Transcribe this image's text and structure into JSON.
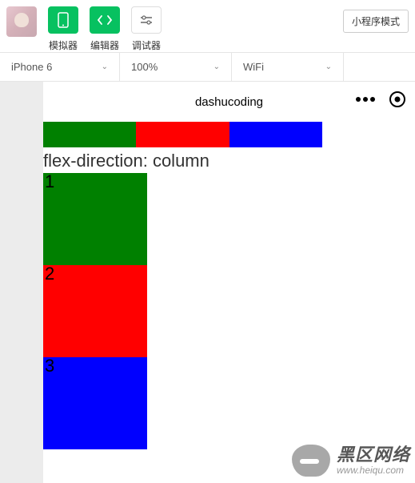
{
  "toolbar": {
    "simulator_label": "模拟器",
    "editor_label": "编辑器",
    "debugger_label": "调试器",
    "mode_label": "小程序模式"
  },
  "dropdowns": {
    "device": "iPhone 6",
    "zoom": "100%",
    "network": "WiFi"
  },
  "phone": {
    "title": "dashucoding"
  },
  "content": {
    "section_title": "flex-direction: column",
    "box1": "1",
    "box2": "2",
    "box3": "3"
  },
  "watermark": {
    "main": "黑区网络",
    "sub": "www.heiqu.com"
  }
}
